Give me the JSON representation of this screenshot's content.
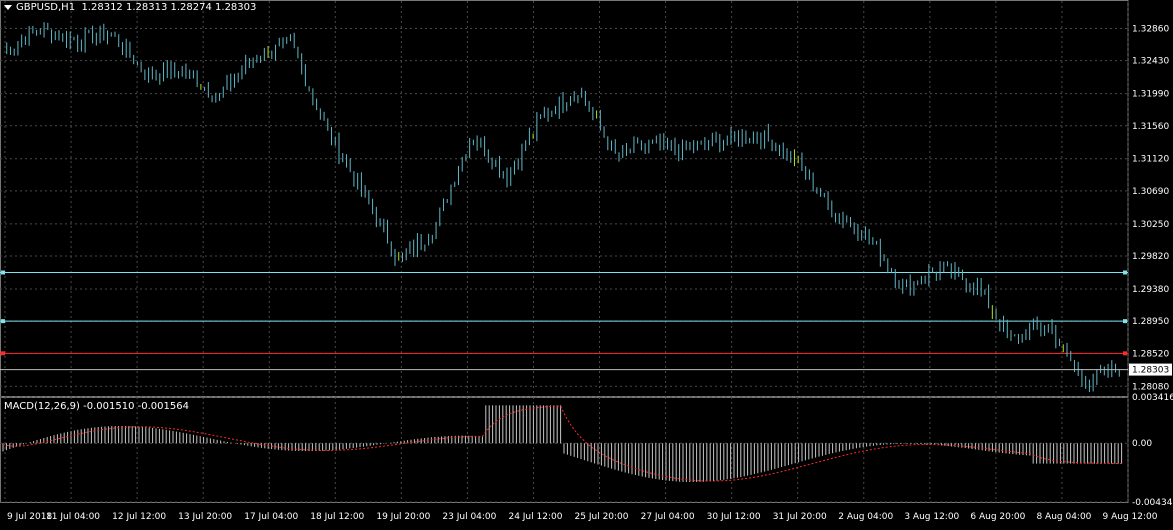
{
  "header": {
    "symbol": "GBPUSD,H1",
    "ohlc": "1.28312 1.28313 1.28274 1.28303"
  },
  "macd": {
    "label": "MACD(12,26,9) -0.001510 -0.001564",
    "axis_labels": [
      "0.003416",
      "0.00",
      "-0.004345"
    ]
  },
  "colors": {
    "background": "#000000",
    "grid": "#4a4a4a",
    "candles": "#5fb8c8",
    "highlight": "#b3e31a",
    "level_lines": "#7fe3ef",
    "red_level": "#ff2a2a",
    "histogram": "#c8c8c8",
    "signal": "#ff2a2a"
  },
  "chart_data": [
    {
      "type": "line",
      "title": "GBPUSD,H1",
      "x": [
        "9 Jul 2018",
        "11 Jul 04:00",
        "12 Jul 12:00",
        "13 Jul 20:00",
        "17 Jul 04:00",
        "18 Jul 12:00",
        "19 Jul 20:00",
        "23 Jul 04:00",
        "24 Jul 12:00",
        "25 Jul 20:00",
        "27 Jul 04:00",
        "30 Jul 12:00",
        "31 Jul 20:00",
        "2 Aug 04:00",
        "3 Aug 12:00",
        "6 Aug 20:00",
        "8 Aug 04:00",
        "9 Aug 12:00"
      ],
      "y_ticks": [
        "1.32860",
        "1.32430",
        "1.31990",
        "1.31560",
        "1.31120",
        "1.30690",
        "1.30250",
        "1.29820",
        "1.29380",
        "1.28950",
        "1.28520",
        "1.28080"
      ],
      "ylim": [
        1.2795,
        1.3308
      ],
      "series": [
        {
          "values": [
            1.3255,
            1.3285,
            1.327,
            1.328,
            1.3225,
            1.323,
            1.3195,
            1.325,
            1.3265,
            1.315,
            1.3065,
            1.2975,
            1.302,
            1.3145,
            1.309,
            1.317,
            1.3205,
            1.3115,
            1.313,
            1.3125,
            1.3135,
            1.3145,
            1.311,
            1.3045,
            1.301,
            1.294,
            1.2965,
            1.2945,
            1.287,
            1.289,
            1.2815,
            1.283
          ]
        }
      ],
      "last_price": "1.28303",
      "horizontal_levels": [
        {
          "value": 1.296
        },
        {
          "value": 1.2895
        },
        {
          "value": 1.2852
        }
      ]
    },
    {
      "type": "bar",
      "title": "MACD(12,26,9)",
      "ylim": [
        -0.004345,
        0.003416
      ],
      "main": -0.00151,
      "signal": -0.001564
    }
  ]
}
